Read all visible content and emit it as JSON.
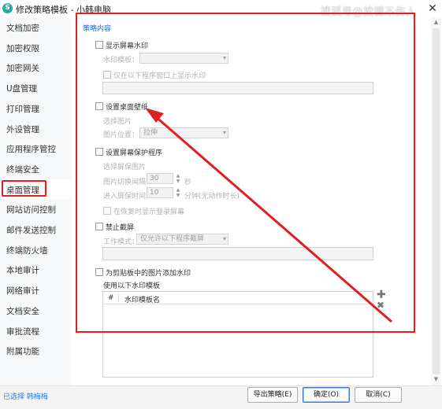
{
  "window": {
    "title": "修改策略模板 - 小韩电脑",
    "app_icon_glyph": "S",
    "close_glyph": "✕",
    "watermark": "搜狐号@按键不伤人"
  },
  "sidebar": {
    "items": [
      {
        "label": "文档加密"
      },
      {
        "label": "加密权限"
      },
      {
        "label": "加密网关"
      },
      {
        "label": "U盘管理"
      },
      {
        "label": "打印管理"
      },
      {
        "label": "外设管理"
      },
      {
        "label": "应用程序管控"
      },
      {
        "label": "终端安全"
      },
      {
        "label": "桌面管理",
        "active": true
      },
      {
        "label": "网站访问控制"
      },
      {
        "label": "邮件发送控制"
      },
      {
        "label": "终端防火墙"
      },
      {
        "label": "本地审计"
      },
      {
        "label": "网络审计"
      },
      {
        "label": "文档安全"
      },
      {
        "label": "审批流程"
      },
      {
        "label": "附属功能"
      }
    ]
  },
  "policy": {
    "section_title": "策略内容",
    "screen_watermark": {
      "label": "显示屏幕水印",
      "template_label": "水印模板：",
      "only_under_label": "仅在以下程序窗口上显示水印"
    },
    "wallpaper": {
      "label": "设置桌面壁纸",
      "choose_label": "选择图片",
      "position_label": "图片位置：",
      "position_value": "拉伸"
    },
    "screensaver": {
      "label": "设置屏幕保护程序",
      "choose_label": "选择屏保图片",
      "switch_label": "图片切换间隔",
      "switch_value": "30",
      "switch_unit": "秒",
      "enter_label": "进入屏保时间",
      "enter_value": "10",
      "enter_unit": "分钟(无动作时长)",
      "show_login_label": "在恢复时显示登录屏幕"
    },
    "screenshot": {
      "label": "禁止截屏",
      "mode_label": "工作模式：",
      "mode_value": "仅允许以下程序截屏"
    },
    "clipboard": {
      "label": "为剪贴板中的图片添加水印",
      "use_template_label": "使用以下水印模板",
      "col_index": "#",
      "col_name": "水印模板名"
    }
  },
  "footer": {
    "selected_info": "已选择 韩梅梅",
    "export_label": "导出策略(E)",
    "ok_label": "确定(O)",
    "cancel_label": "取消(C)"
  },
  "icons": {
    "plus": "✚",
    "cross": "✖",
    "dropdown_arrow": "▾",
    "spin_up": "▲",
    "spin_down": "▼",
    "scroll_up": "▲",
    "scroll_down": "▼"
  },
  "colors": {
    "highlight_red": "#e02020",
    "link_blue": "#1b6fd1"
  }
}
